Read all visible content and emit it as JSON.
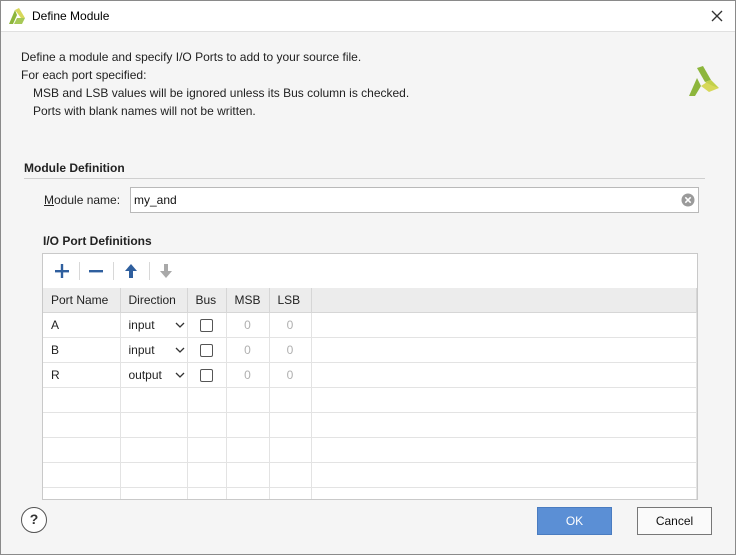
{
  "window": {
    "title": "Define Module",
    "app_icon": "xilinx-vivado-logo-icon",
    "close_icon": "close-icon"
  },
  "intro": {
    "line1": "Define a module and specify I/O Ports to add to your source file.",
    "line2": "For each port specified:",
    "line3": "MSB and LSB values will be ignored unless its Bus column is checked.",
    "line4": "Ports with blank names will not be written."
  },
  "module_definition": {
    "section_title": "Module Definition",
    "name_label_prefix": "M",
    "name_label_rest": "odule name:",
    "name_value": "my_and"
  },
  "io_ports": {
    "section_title": "I/O Port Definitions",
    "toolbar": {
      "add_icon": "plus-icon",
      "remove_icon": "minus-icon",
      "move_up_icon": "arrow-up-icon",
      "move_down_icon": "arrow-down-icon"
    },
    "columns": [
      "Port Name",
      "Direction",
      "Bus",
      "MSB",
      "LSB"
    ],
    "rows": [
      {
        "name": "A",
        "direction": "input",
        "bus": false,
        "msb": "0",
        "lsb": "0"
      },
      {
        "name": "B",
        "direction": "input",
        "bus": false,
        "msb": "0",
        "lsb": "0"
      },
      {
        "name": "R",
        "direction": "output",
        "bus": false,
        "msb": "0",
        "lsb": "0"
      }
    ]
  },
  "footer": {
    "help_label": "?",
    "ok_label": "OK",
    "cancel_label": "Cancel"
  },
  "colors": {
    "accent": "#5b8fd5",
    "logo_green": "#8db63c",
    "logo_yellow": "#d7d85a"
  }
}
